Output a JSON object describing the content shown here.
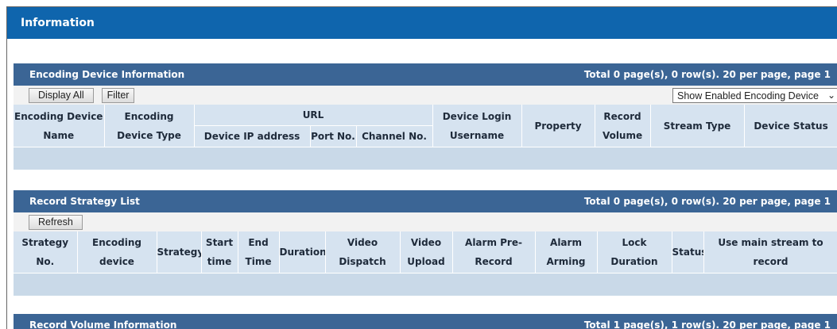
{
  "window": {
    "title": "Information"
  },
  "encoding": {
    "title": "Encoding Device Information",
    "paging": "Total 0 page(s), 0 row(s). 20 per page, page 1",
    "buttons": {
      "display_all": "Display All",
      "filter": "Filter"
    },
    "filter_select": "Show Enabled Encoding Device",
    "headers": {
      "name_1": "Encoding Device",
      "name_2": "Name",
      "type_1": "Encoding",
      "type_2": "Device Type",
      "url": "URL",
      "ip": "Device IP address",
      "port": "Port No.",
      "channel": "Channel No.",
      "login_1": "Device Login",
      "login_2": "Username",
      "property": "Property",
      "volume_1": "Record",
      "volume_2": "Volume",
      "stream": "Stream Type",
      "status": "Device Status"
    }
  },
  "strategy": {
    "title": "Record Strategy List",
    "paging": "Total 0 page(s), 0 row(s). 20 per page, page 1",
    "buttons": {
      "refresh": "Refresh"
    },
    "headers": {
      "no_1": "Strategy",
      "no_2": "No.",
      "device_1": "Encoding",
      "device_2": "device",
      "strategy": "Strategy",
      "start_1": "Start",
      "start_2": "time",
      "end_1": "End",
      "end_2": "Time",
      "duration": "Duration",
      "dispatch_1": "Video",
      "dispatch_2": "Dispatch",
      "upload_1": "Video",
      "upload_2": "Upload",
      "prerecord_1": "Alarm Pre-",
      "prerecord_2": "Record",
      "arming_1": "Alarm",
      "arming_2": "Arming",
      "lock_1": "Lock",
      "lock_2": "Duration",
      "status": "Status",
      "main_1": "Use main stream to",
      "main_2": "record"
    }
  },
  "volume": {
    "title": "Record Volume Information",
    "paging": "Total 1 page(s), 1 row(s). 20 per page, page 1"
  }
}
